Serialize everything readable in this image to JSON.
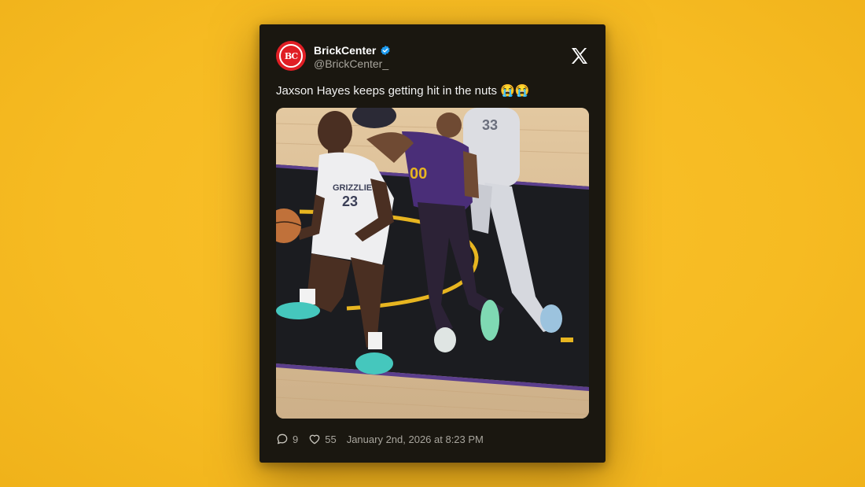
{
  "tweet": {
    "author_name": "BrickCenter",
    "handle": "@BrickCenter_",
    "avatar_text": "BC",
    "text": "Jaxson Hayes keeps getting hit in the nuts 😭😭",
    "replies": "9",
    "likes": "55",
    "timestamp": "January 2nd, 2026 at 8:23 PM"
  },
  "media": {
    "jersey_number_left": "23",
    "jersey_team_left": "GRIZZLIES",
    "jersey_number_right": "33"
  },
  "colors": {
    "background": "#f6bb22",
    "card": "#1a1710",
    "avatar": "#e01e24",
    "verified": "#1d9bf0",
    "muted_text": "#a8a59d"
  },
  "icons": [
    "verified-badge-icon",
    "x-logo-icon",
    "reply-icon",
    "heart-icon"
  ]
}
